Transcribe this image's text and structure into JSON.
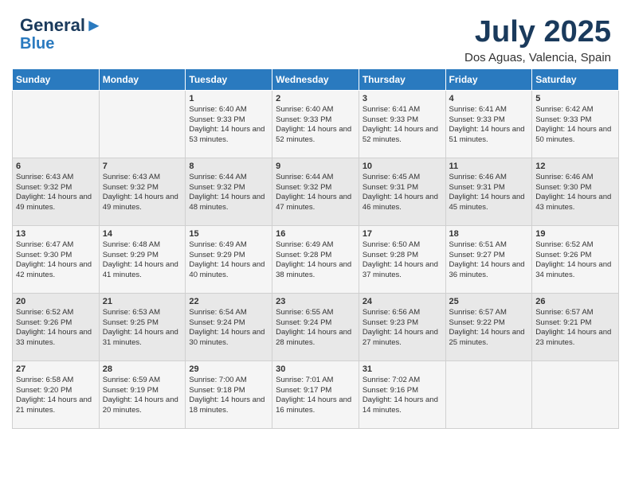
{
  "header": {
    "logo_line1": "General",
    "logo_line2": "Blue",
    "month": "July 2025",
    "location": "Dos Aguas, Valencia, Spain"
  },
  "days_of_week": [
    "Sunday",
    "Monday",
    "Tuesday",
    "Wednesday",
    "Thursday",
    "Friday",
    "Saturday"
  ],
  "weeks": [
    [
      {
        "day": "",
        "sunrise": "",
        "sunset": "",
        "daylight": ""
      },
      {
        "day": "",
        "sunrise": "",
        "sunset": "",
        "daylight": ""
      },
      {
        "day": "1",
        "sunrise": "Sunrise: 6:40 AM",
        "sunset": "Sunset: 9:33 PM",
        "daylight": "Daylight: 14 hours and 53 minutes."
      },
      {
        "day": "2",
        "sunrise": "Sunrise: 6:40 AM",
        "sunset": "Sunset: 9:33 PM",
        "daylight": "Daylight: 14 hours and 52 minutes."
      },
      {
        "day": "3",
        "sunrise": "Sunrise: 6:41 AM",
        "sunset": "Sunset: 9:33 PM",
        "daylight": "Daylight: 14 hours and 52 minutes."
      },
      {
        "day": "4",
        "sunrise": "Sunrise: 6:41 AM",
        "sunset": "Sunset: 9:33 PM",
        "daylight": "Daylight: 14 hours and 51 minutes."
      },
      {
        "day": "5",
        "sunrise": "Sunrise: 6:42 AM",
        "sunset": "Sunset: 9:33 PM",
        "daylight": "Daylight: 14 hours and 50 minutes."
      }
    ],
    [
      {
        "day": "6",
        "sunrise": "Sunrise: 6:43 AM",
        "sunset": "Sunset: 9:32 PM",
        "daylight": "Daylight: 14 hours and 49 minutes."
      },
      {
        "day": "7",
        "sunrise": "Sunrise: 6:43 AM",
        "sunset": "Sunset: 9:32 PM",
        "daylight": "Daylight: 14 hours and 49 minutes."
      },
      {
        "day": "8",
        "sunrise": "Sunrise: 6:44 AM",
        "sunset": "Sunset: 9:32 PM",
        "daylight": "Daylight: 14 hours and 48 minutes."
      },
      {
        "day": "9",
        "sunrise": "Sunrise: 6:44 AM",
        "sunset": "Sunset: 9:32 PM",
        "daylight": "Daylight: 14 hours and 47 minutes."
      },
      {
        "day": "10",
        "sunrise": "Sunrise: 6:45 AM",
        "sunset": "Sunset: 9:31 PM",
        "daylight": "Daylight: 14 hours and 46 minutes."
      },
      {
        "day": "11",
        "sunrise": "Sunrise: 6:46 AM",
        "sunset": "Sunset: 9:31 PM",
        "daylight": "Daylight: 14 hours and 45 minutes."
      },
      {
        "day": "12",
        "sunrise": "Sunrise: 6:46 AM",
        "sunset": "Sunset: 9:30 PM",
        "daylight": "Daylight: 14 hours and 43 minutes."
      }
    ],
    [
      {
        "day": "13",
        "sunrise": "Sunrise: 6:47 AM",
        "sunset": "Sunset: 9:30 PM",
        "daylight": "Daylight: 14 hours and 42 minutes."
      },
      {
        "day": "14",
        "sunrise": "Sunrise: 6:48 AM",
        "sunset": "Sunset: 9:29 PM",
        "daylight": "Daylight: 14 hours and 41 minutes."
      },
      {
        "day": "15",
        "sunrise": "Sunrise: 6:49 AM",
        "sunset": "Sunset: 9:29 PM",
        "daylight": "Daylight: 14 hours and 40 minutes."
      },
      {
        "day": "16",
        "sunrise": "Sunrise: 6:49 AM",
        "sunset": "Sunset: 9:28 PM",
        "daylight": "Daylight: 14 hours and 38 minutes."
      },
      {
        "day": "17",
        "sunrise": "Sunrise: 6:50 AM",
        "sunset": "Sunset: 9:28 PM",
        "daylight": "Daylight: 14 hours and 37 minutes."
      },
      {
        "day": "18",
        "sunrise": "Sunrise: 6:51 AM",
        "sunset": "Sunset: 9:27 PM",
        "daylight": "Daylight: 14 hours and 36 minutes."
      },
      {
        "day": "19",
        "sunrise": "Sunrise: 6:52 AM",
        "sunset": "Sunset: 9:26 PM",
        "daylight": "Daylight: 14 hours and 34 minutes."
      }
    ],
    [
      {
        "day": "20",
        "sunrise": "Sunrise: 6:52 AM",
        "sunset": "Sunset: 9:26 PM",
        "daylight": "Daylight: 14 hours and 33 minutes."
      },
      {
        "day": "21",
        "sunrise": "Sunrise: 6:53 AM",
        "sunset": "Sunset: 9:25 PM",
        "daylight": "Daylight: 14 hours and 31 minutes."
      },
      {
        "day": "22",
        "sunrise": "Sunrise: 6:54 AM",
        "sunset": "Sunset: 9:24 PM",
        "daylight": "Daylight: 14 hours and 30 minutes."
      },
      {
        "day": "23",
        "sunrise": "Sunrise: 6:55 AM",
        "sunset": "Sunset: 9:24 PM",
        "daylight": "Daylight: 14 hours and 28 minutes."
      },
      {
        "day": "24",
        "sunrise": "Sunrise: 6:56 AM",
        "sunset": "Sunset: 9:23 PM",
        "daylight": "Daylight: 14 hours and 27 minutes."
      },
      {
        "day": "25",
        "sunrise": "Sunrise: 6:57 AM",
        "sunset": "Sunset: 9:22 PM",
        "daylight": "Daylight: 14 hours and 25 minutes."
      },
      {
        "day": "26",
        "sunrise": "Sunrise: 6:57 AM",
        "sunset": "Sunset: 9:21 PM",
        "daylight": "Daylight: 14 hours and 23 minutes."
      }
    ],
    [
      {
        "day": "27",
        "sunrise": "Sunrise: 6:58 AM",
        "sunset": "Sunset: 9:20 PM",
        "daylight": "Daylight: 14 hours and 21 minutes."
      },
      {
        "day": "28",
        "sunrise": "Sunrise: 6:59 AM",
        "sunset": "Sunset: 9:19 PM",
        "daylight": "Daylight: 14 hours and 20 minutes."
      },
      {
        "day": "29",
        "sunrise": "Sunrise: 7:00 AM",
        "sunset": "Sunset: 9:18 PM",
        "daylight": "Daylight: 14 hours and 18 minutes."
      },
      {
        "day": "30",
        "sunrise": "Sunrise: 7:01 AM",
        "sunset": "Sunset: 9:17 PM",
        "daylight": "Daylight: 14 hours and 16 minutes."
      },
      {
        "day": "31",
        "sunrise": "Sunrise: 7:02 AM",
        "sunset": "Sunset: 9:16 PM",
        "daylight": "Daylight: 14 hours and 14 minutes."
      },
      {
        "day": "",
        "sunrise": "",
        "sunset": "",
        "daylight": ""
      },
      {
        "day": "",
        "sunrise": "",
        "sunset": "",
        "daylight": ""
      }
    ]
  ]
}
